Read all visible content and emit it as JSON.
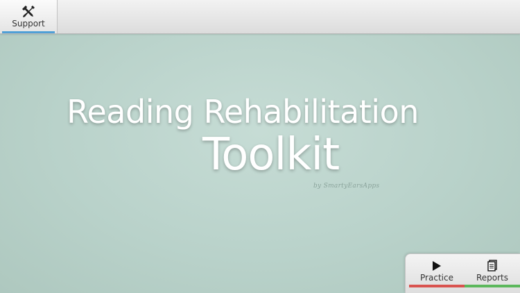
{
  "header": {
    "support_label": "Support",
    "support_icon": "tools-icon",
    "support_accent": "#4f9fd6"
  },
  "main": {
    "title_line1": "Reading Rehabilitation",
    "title_line2": "Toolkit",
    "byline": "by SmartyEarsApps"
  },
  "footer": {
    "practice": {
      "label": "Practice",
      "icon": "play-icon",
      "accent": "#d9534f"
    },
    "reports": {
      "label": "Reports",
      "icon": "document-icon",
      "accent": "#5cb85c"
    }
  },
  "colors": {
    "background": "#b9d2ca"
  }
}
